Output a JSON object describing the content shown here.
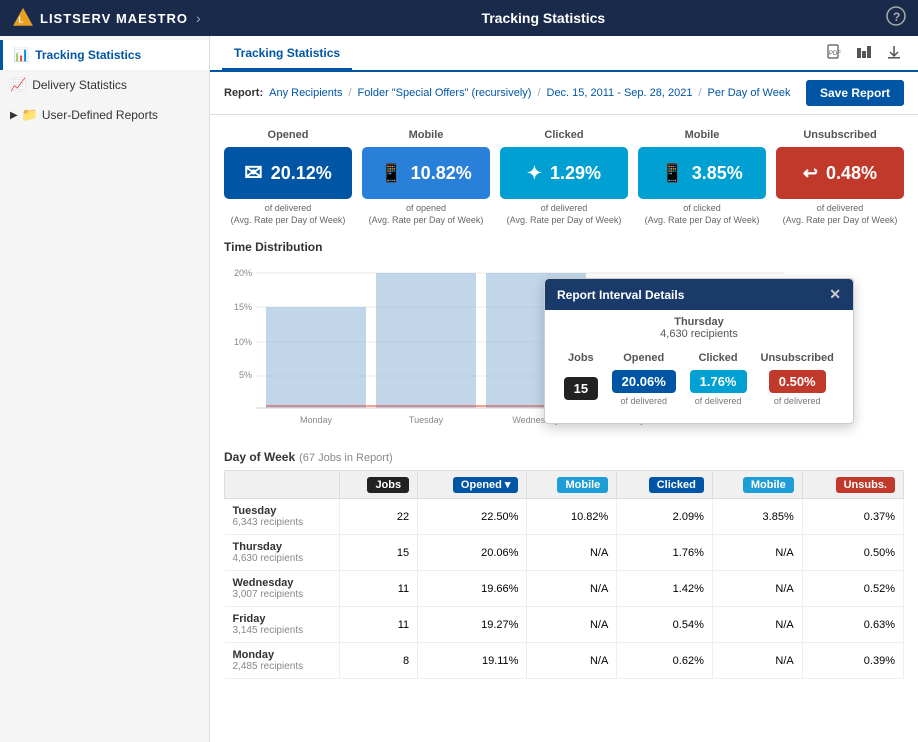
{
  "app": {
    "title": "LISTSERV MAESTRO",
    "page_title": "Tracking Statistics",
    "help_icon": "?"
  },
  "sidebar": {
    "items": [
      {
        "id": "tracking-statistics",
        "label": "Tracking Statistics",
        "icon": "📊",
        "active": true
      },
      {
        "id": "delivery-statistics",
        "label": "Delivery Statistics",
        "icon": "📈",
        "active": false
      },
      {
        "id": "user-defined-reports",
        "label": "User-Defined Reports",
        "icon": "📁",
        "active": false,
        "type": "folder"
      }
    ]
  },
  "tab_bar": {
    "active_tab": "Tracking Statistics",
    "icons": [
      "📄",
      "📊",
      "⬇"
    ]
  },
  "filter_bar": {
    "label": "Report:",
    "filters": [
      {
        "text": "Any Recipients",
        "link": true
      },
      {
        "text": "/",
        "link": false
      },
      {
        "text": "Folder \"Special Offers\" (recursively)",
        "link": true
      },
      {
        "text": "/",
        "link": false
      },
      {
        "text": "Dec. 15, 2011 - Sep. 28, 2021",
        "link": true
      },
      {
        "text": "/",
        "link": false
      },
      {
        "text": "Per Day of Week",
        "link": true
      }
    ],
    "save_button": "Save Report"
  },
  "stat_cards": [
    {
      "id": "opened",
      "label": "Opened",
      "value": "20.12%",
      "sub": "of delivered\n(Avg. Rate per Day of Week)",
      "color": "blue",
      "icon": "✉"
    },
    {
      "id": "mobile-opened",
      "label": "Mobile",
      "value": "10.82%",
      "sub": "of opened\n(Avg. Rate per Day of Week)",
      "color": "blue-light",
      "icon": "📱"
    },
    {
      "id": "clicked",
      "label": "Clicked",
      "value": "1.29%",
      "sub": "of delivered\n(Avg. Rate per Day of Week)",
      "color": "cyan",
      "icon": "👆"
    },
    {
      "id": "mobile-clicked",
      "label": "Mobile",
      "value": "3.85%",
      "sub": "of clicked\n(Avg. Rate per Day of Week)",
      "color": "cyan",
      "icon": "📱"
    },
    {
      "id": "unsubscribed",
      "label": "Unsubscribed",
      "value": "0.48%",
      "sub": "of delivered\n(Avg. Rate per Day of Week)",
      "color": "red",
      "icon": "↩"
    }
  ],
  "chart": {
    "title": "Time Distribution",
    "y_labels": [
      "20%",
      "15%",
      "10%",
      "5%"
    ],
    "x_labels": [
      "Monday",
      "Tuesday",
      "Wednesday",
      "Thursday"
    ],
    "bars": [
      {
        "day": "Monday",
        "height_pct": 55
      },
      {
        "day": "Tuesday",
        "height_pct": 72
      },
      {
        "day": "Wednesday",
        "height_pct": 72
      },
      {
        "day": "Thursday",
        "height_pct": 60
      }
    ]
  },
  "tooltip": {
    "title": "Report Interval Details",
    "day": "Thursday",
    "recipients": "4,630 recipients",
    "columns": [
      "Jobs",
      "Opened",
      "Clicked",
      "Unsubscribed"
    ],
    "values": [
      {
        "label": "15",
        "color": "black"
      },
      {
        "label": "20.06%",
        "sub": "of delivered",
        "color": "blue"
      },
      {
        "label": "1.76%",
        "sub": "of delivered",
        "color": "cyan"
      },
      {
        "label": "0.50%",
        "sub": "of delivered",
        "color": "red"
      }
    ]
  },
  "table": {
    "title": "Day of Week",
    "subtitle": "(67 Jobs in Report)",
    "columns": [
      {
        "label": "",
        "badge": null,
        "align": "left"
      },
      {
        "label": "Jobs",
        "badge": "black"
      },
      {
        "label": "Opened ▾",
        "badge": "blue"
      },
      {
        "label": "Mobile",
        "badge": "cyan"
      },
      {
        "label": "Clicked",
        "badge": "blue"
      },
      {
        "label": "Mobile",
        "badge": "cyan"
      },
      {
        "label": "Unsubs.",
        "badge": "red"
      }
    ],
    "rows": [
      {
        "name": "Tuesday",
        "sub": "6,343 recipients",
        "jobs": 22,
        "opened": "22.50%",
        "mobile_o": "10.82%",
        "clicked": "2.09%",
        "mobile_c": "3.85%",
        "unsubs": "0.37%"
      },
      {
        "name": "Thursday",
        "sub": "4,630 recipients",
        "jobs": 15,
        "opened": "20.06%",
        "mobile_o": "N/A",
        "clicked": "1.76%",
        "mobile_c": "N/A",
        "unsubs": "0.50%"
      },
      {
        "name": "Wednesday",
        "sub": "3,007 recipients",
        "jobs": 11,
        "opened": "19.66%",
        "mobile_o": "N/A",
        "clicked": "1.42%",
        "mobile_c": "N/A",
        "unsubs": "0.52%"
      },
      {
        "name": "Friday",
        "sub": "3,145 recipients",
        "jobs": 11,
        "opened": "19.27%",
        "mobile_o": "N/A",
        "clicked": "0.54%",
        "mobile_c": "N/A",
        "unsubs": "0.63%"
      },
      {
        "name": "Monday",
        "sub": "2,485 recipients",
        "jobs": 8,
        "opened": "19.11%",
        "mobile_o": "N/A",
        "clicked": "0.62%",
        "mobile_c": "N/A",
        "unsubs": "0.39%"
      }
    ]
  }
}
